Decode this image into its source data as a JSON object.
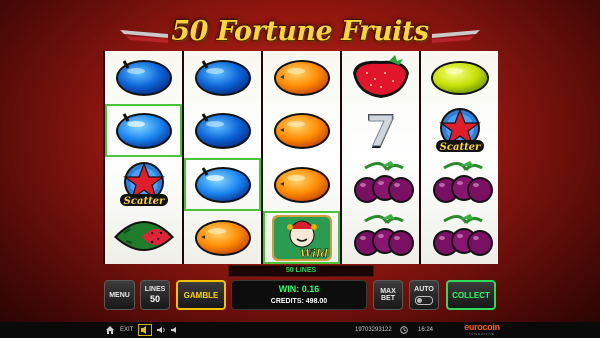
{
  "game": {
    "title": "50 Fortune Fruits",
    "lines_banner": "50 LINES",
    "reels": [
      [
        "plum",
        "plum-highlight",
        "scatter",
        "watermelon"
      ],
      [
        "plum",
        "plum",
        "plum-highlight",
        "orange"
      ],
      [
        "orange",
        "orange",
        "orange",
        "wild"
      ],
      [
        "strawberry",
        "seven",
        "cherries",
        "cherries"
      ],
      [
        "lemon",
        "scatter",
        "cherries",
        "cherries"
      ]
    ],
    "scatter_label": "Scatter",
    "wild_label": "Wild"
  },
  "controls": {
    "menu_label": "MENU",
    "lines_label": "LINES",
    "lines_value": "50",
    "gamble_label": "GAMBLE",
    "win_text": "WIN: 0.16",
    "credits_text": "CREDITS: 498.00",
    "max_bet_line1": "MAX",
    "max_bet_line2": "BET",
    "auto_label": "AUTO",
    "collect_label": "COLLECT"
  },
  "bottom_bar": {
    "exit_label": "EXIT",
    "session_id": "19703293122",
    "clock": "16:24",
    "logo_text": "eurocoin",
    "logo_sub": "INTERACTIVE"
  },
  "colors": {
    "accent_gold": "#ffd500",
    "accent_green": "#2fd95a",
    "background_red": "#8e160f"
  }
}
